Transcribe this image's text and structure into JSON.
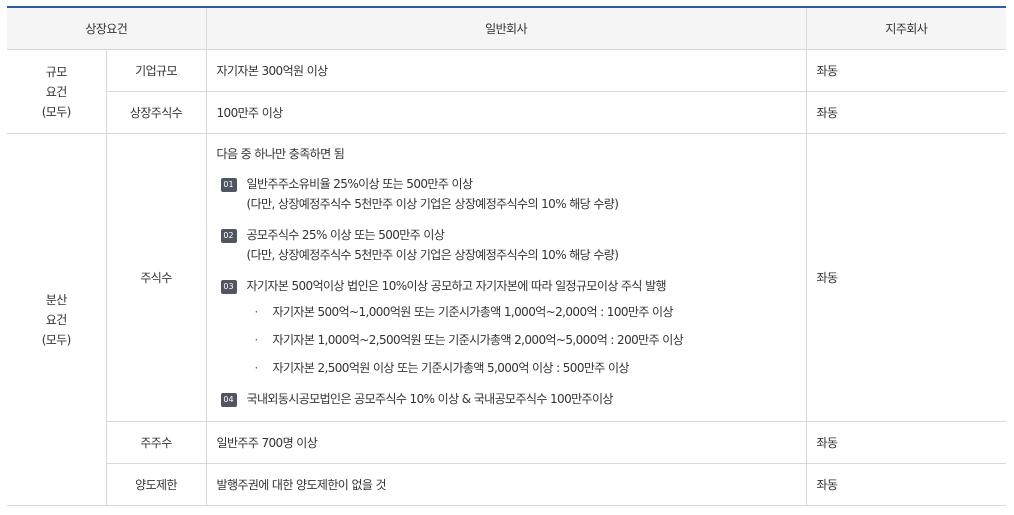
{
  "headers": {
    "requirement": "상장요건",
    "general": "일반회사",
    "holding": "지주회사"
  },
  "groups": {
    "size": {
      "line1": "규모",
      "line2": "요건",
      "line3": "(모두)"
    },
    "distribution": {
      "line1": "분산",
      "line2": "요건",
      "line3": "(모두)"
    }
  },
  "rows": {
    "company_size": {
      "label": "기업규모",
      "general": "자기자본 300억원 이상",
      "holding": "좌동"
    },
    "listed_shares": {
      "label": "상장주식수",
      "general": "100만주 이상",
      "holding": "좌동"
    },
    "shares": {
      "label": "주식수",
      "intro": "다음 중 하나만 충족하면 됨",
      "holding": "좌동",
      "items": [
        {
          "badge": "01",
          "text": "일반주주소유비율 25%이상 또는 500만주 이상",
          "note": "(다만, 상장예정주식수 5천만주 이상 기업은 상장예정주식수의 10% 해당 수량)"
        },
        {
          "badge": "02",
          "text": "공모주식수 25% 이상 또는 500만주 이상",
          "note": "(다만, 상장예정주식수 5천만주 이상 기업은 상장예정주식수의 10% 해당 수량)"
        },
        {
          "badge": "03",
          "text": "자기자본 500억이상 법인은 10%이상 공모하고 자기자본에 따라 일정규모이상 주식 발행",
          "sub": [
            "자기자본 500억~1,000억원 또는 기준시가총액 1,000억~2,000억 : 100만주 이상",
            "자기자본 1,000억~2,500억원 또는 기준시가총액 2,000억~5,000억 : 200만주 이상",
            "자기자본 2,500억원 이상 또는 기준시가총액 5,000억 이상 : 500만주 이상"
          ]
        },
        {
          "badge": "04",
          "text": "국내외동시공모법인은 공모주식수 10% 이상 & 국내공모주식수 100만주이상"
        }
      ]
    },
    "shareholders": {
      "label": "주주수",
      "general": "일반주주 700명 이상",
      "holding": "좌동"
    },
    "transfer": {
      "label": "양도제한",
      "general": "발행주권에 대한 양도제한이 없을 것",
      "holding": "좌동"
    }
  }
}
